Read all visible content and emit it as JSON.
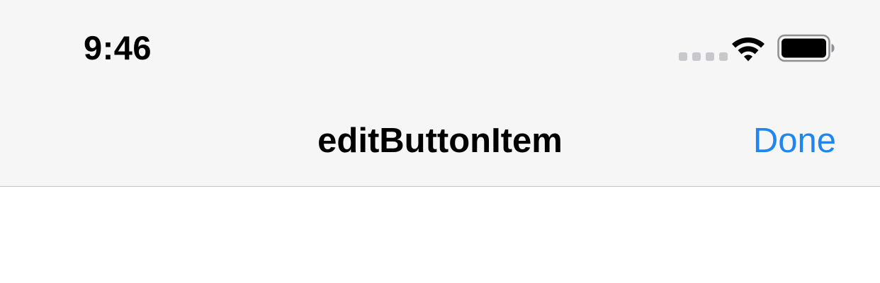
{
  "status_bar": {
    "time": "9:46",
    "signal_icon": "cellular-signal-icon",
    "wifi_icon": "wifi-icon",
    "battery_icon": "battery-icon",
    "battery_level": 1.0
  },
  "nav_bar": {
    "title": "editButtonItem",
    "done_label": "Done"
  },
  "colors": {
    "accent": "#1f86f1",
    "bar_background": "#f6f6f7",
    "separator": "#c4c4c6"
  }
}
